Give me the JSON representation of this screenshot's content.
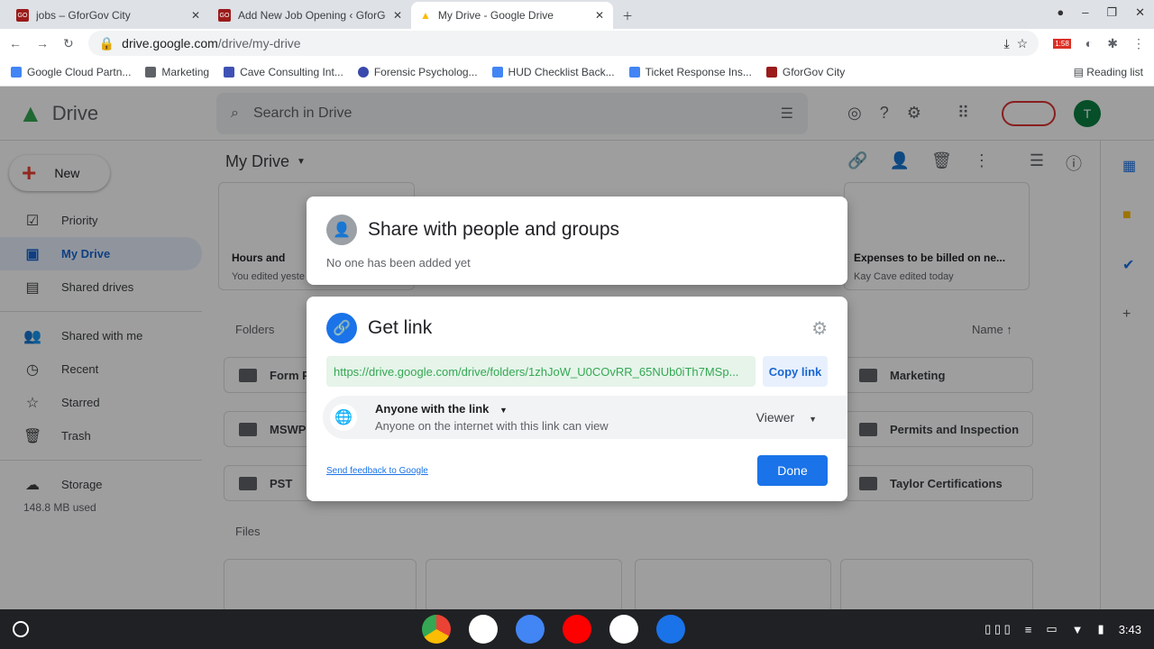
{
  "browser": {
    "tabs": [
      {
        "title": "jobs – GforGov City",
        "active": false
      },
      {
        "title": "Add New Job Opening ‹ GforGov",
        "active": false
      },
      {
        "title": "My Drive - Google Drive",
        "active": true
      }
    ],
    "url_host": "drive.google.com",
    "url_path": "/drive/my-drive",
    "bookmarks": [
      "Google Cloud Partn...",
      "Marketing",
      "Cave Consulting Int...",
      "Forensic Psycholog...",
      "HUD Checklist Back...",
      "Ticket Response Ins...",
      "GforGov City"
    ],
    "reading_list": "Reading list",
    "badge": "1:58"
  },
  "drive": {
    "logo": "Drive",
    "search_placeholder": "Search in Drive",
    "avatar": "T",
    "new_label": "New",
    "nav": [
      {
        "label": "Priority",
        "icon": "☑"
      },
      {
        "label": "My Drive",
        "icon": "▣",
        "selected": true
      },
      {
        "label": "Shared drives",
        "icon": "▤"
      },
      {
        "label": "Shared with me",
        "icon": "👥"
      },
      {
        "label": "Recent",
        "icon": "◷"
      },
      {
        "label": "Starred",
        "icon": "☆"
      },
      {
        "label": "Trash",
        "icon": "🗑"
      },
      {
        "label": "Storage",
        "icon": "☁"
      }
    ],
    "storage_used": "148.8 MB used",
    "title": "My Drive",
    "suggested": [
      {
        "name": "Hours and",
        "meta": "You edited yeste"
      },
      {
        "name": "Expenses to be billed on ne...",
        "meta": "Kay Cave edited today"
      }
    ],
    "folders_label": "Folders",
    "sort_label": "Name",
    "files_label": "Files",
    "folders": [
      "Form P",
      "MSWP",
      "PST",
      "Marketing",
      "Permits and Inspection",
      "Taylor Certifications"
    ]
  },
  "share": {
    "title": "Share with people and groups",
    "subtitle": "No one has been added yet"
  },
  "link": {
    "title": "Get link",
    "url": "https://drive.google.com/drive/folders/1zhJoW_U0COvRR_65NUb0iTh7MSp...",
    "copy": "Copy link",
    "access": "Anyone with the link",
    "access_desc": "Anyone on the internet with this link can view",
    "role": "Viewer",
    "feedback": "Send feedback to Google",
    "done": "Done"
  },
  "shelf": {
    "time": "3:43"
  },
  "colors": {
    "accent": "#1a73e8",
    "link_bg": "#e6f4ea",
    "link_text": "#34a853"
  }
}
